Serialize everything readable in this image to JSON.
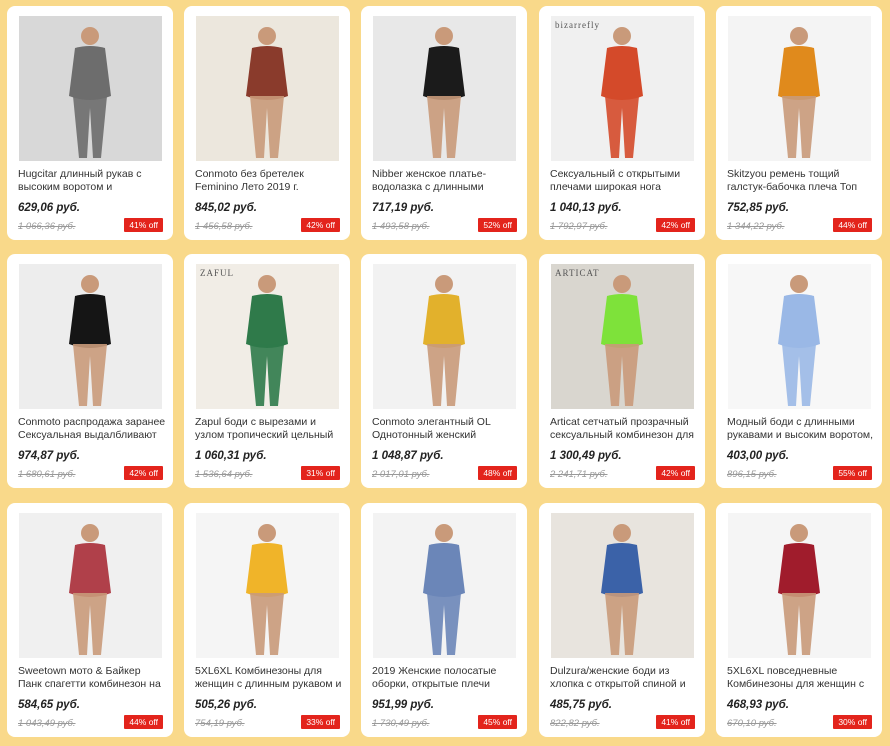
{
  "accent_color": "#e3241c",
  "background_color": "#f9d98a",
  "products": [
    {
      "title": "Hugcitar длинный рукав с высоким воротом и",
      "price": "629,06 руб.",
      "old_price": "1 066,36 руб.",
      "discount": "41% off",
      "brand_mark": ""
    },
    {
      "title": "Conmoto без бретелек Feminino Лето 2019 г.",
      "price": "845,02 руб.",
      "old_price": "1 456,58 руб.",
      "discount": "42% off",
      "brand_mark": ""
    },
    {
      "title": "Nibber женское платье-водолазка с длинными",
      "price": "717,19 руб.",
      "old_price": "1 493,58 руб.",
      "discount": "52% off",
      "brand_mark": ""
    },
    {
      "title": "Сексуальный с открытыми плечами широкая нога",
      "price": "1 040,13 руб.",
      "old_price": "1 792,97 руб.",
      "discount": "42% off",
      "brand_mark": "bizarrefly"
    },
    {
      "title": "Skitzyou ремень тощий галстук-бабочка плеча Топ",
      "price": "752,85 руб.",
      "old_price": "1 344,22 руб.",
      "discount": "44% off",
      "brand_mark": ""
    },
    {
      "title": "Conmoto распродажа заранее Сексуальная выдалбливают",
      "price": "974,87 руб.",
      "old_price": "1 680,61 руб.",
      "discount": "42% off",
      "brand_mark": ""
    },
    {
      "title": "Zapul боди с вырезами и узлом тропический цельный",
      "price": "1 060,31 руб.",
      "old_price": "1 536,64 руб.",
      "discount": "31% off",
      "brand_mark": "ZAFUL"
    },
    {
      "title": "Conmoto элегантный OL Однотонный женский",
      "price": "1 048,87 руб.",
      "old_price": "2 017,01 руб.",
      "discount": "48% off",
      "brand_mark": ""
    },
    {
      "title": "Articat сетчатый прозрачный сексуальный комбинезон для",
      "price": "1 300,49 руб.",
      "old_price": "2 241,71 руб.",
      "discount": "42% off",
      "brand_mark": "ARTICAT"
    },
    {
      "title": "Модный боди с длинными рукавами и высоким воротом,",
      "price": "403,00 руб.",
      "old_price": "896,15 руб.",
      "discount": "55% off",
      "brand_mark": ""
    },
    {
      "title": "Sweetown мото & Байкер Панк спагетти комбинезон на",
      "price": "584,65 руб.",
      "old_price": "1 043,49 руб.",
      "discount": "44% off",
      "brand_mark": ""
    },
    {
      "title": "5XL6XL Комбинезоны для женщин с длинным рукавом и",
      "price": "505,26 руб.",
      "old_price": "754,19 руб.",
      "discount": "33% off",
      "brand_mark": ""
    },
    {
      "title": "2019 Женские полосатые оборки, открытые плечи",
      "price": "951,99 руб.",
      "old_price": "1 730,49 руб.",
      "discount": "45% off",
      "brand_mark": ""
    },
    {
      "title": "Dulzura/женские боди из хлопка с открытой спиной и",
      "price": "485,75 руб.",
      "old_price": "822,82 руб.",
      "discount": "41% off",
      "brand_mark": ""
    },
    {
      "title": "5XL6XL повседневные Комбинезоны для женщин с",
      "price": "468,93 руб.",
      "old_price": "670,10 руб.",
      "discount": "30% off",
      "brand_mark": ""
    }
  ]
}
